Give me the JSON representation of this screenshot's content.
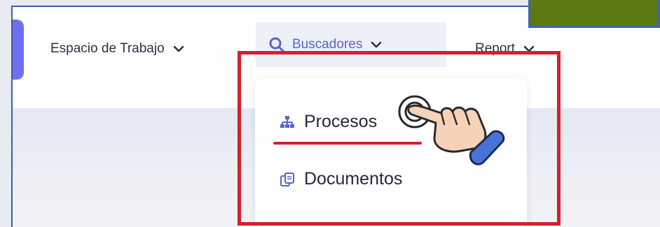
{
  "nav": {
    "workspace_label": "Espacio de Trabajo",
    "search_label": "Buscadores",
    "report_label": "Report"
  },
  "dropdown": {
    "items": [
      {
        "label": "Procesos",
        "icon": "sitemap-icon"
      },
      {
        "label": "Documentos",
        "icon": "documents-icon"
      }
    ]
  },
  "colors": {
    "accent": "#5a63c9",
    "highlight": "#d5202a",
    "logo_tab": "#6e6ff0",
    "green_box": "#5d7a12"
  }
}
